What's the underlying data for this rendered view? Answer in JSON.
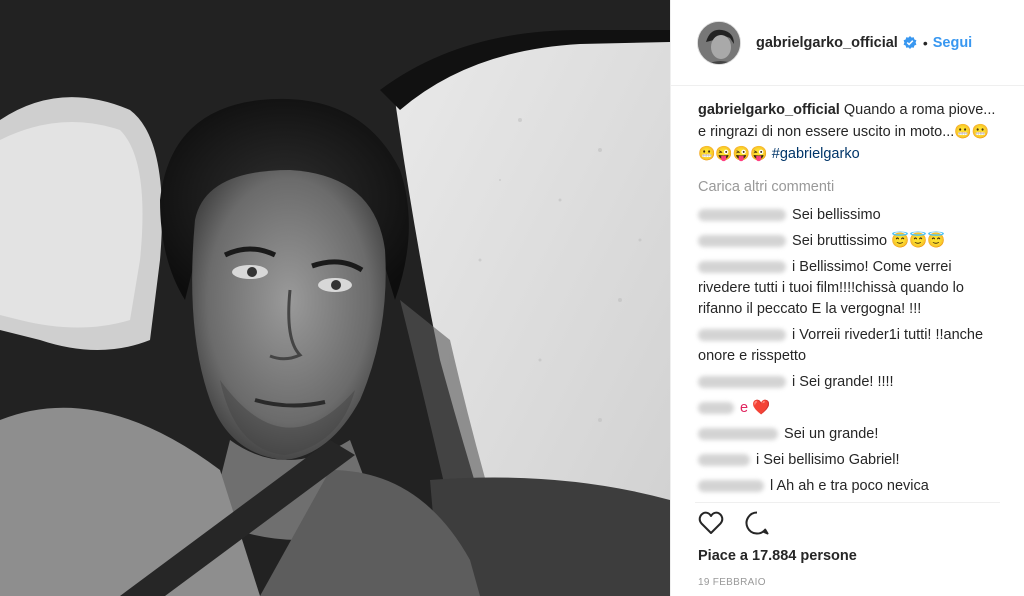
{
  "post": {
    "username": "gabrielgarko_official",
    "follow_label": "Segui",
    "separator": "•",
    "caption_author": "gabrielgarko_official",
    "caption_text": "Quando a roma piove... e ringrazi di non essere uscito in moto...",
    "caption_emojis": "😬😬😬😜😜😜",
    "caption_hashtag": "#gabrielgarko",
    "load_more": "Carica altri commenti",
    "likes": "Piace a 17.884 persone",
    "date": "19 FEBBRAIO"
  },
  "comments": [
    {
      "text": "Sei bellissimo"
    },
    {
      "text": "Sei bruttissimo 😇😇😇"
    },
    {
      "text": "i Bellissimo! Come verrei rivedere tutti i tuoi film!!!!chissà quando lo rifanno il peccato E la vergogna! !!!"
    },
    {
      "text": "i Vorreii riveder1i tutti! !!anche onore e risspetto"
    },
    {
      "text": "i Sei grande! !!!!"
    },
    {
      "text": "e ❤️"
    },
    {
      "text": "Sei un grande!"
    },
    {
      "text": "i Sei bellisimo Gabriel!"
    },
    {
      "text": "l Ah ah e tra poco nevica"
    }
  ],
  "icons": {
    "heart": "heart-outline-icon",
    "comment": "comment-outline-icon",
    "verified": "verified-badge-icon"
  },
  "colors": {
    "link": "#3897f0",
    "hashtag": "#003569",
    "muted": "#999999"
  }
}
